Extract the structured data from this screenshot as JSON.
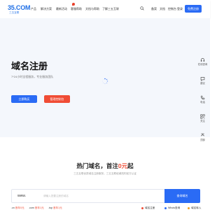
{
  "logo": {
    "text": "35.COM",
    "subtitle": "三五互联"
  },
  "nav": {
    "items": [
      {
        "label": "产品"
      },
      {
        "label": "解决方案"
      },
      {
        "label": "最新活动"
      },
      {
        "label": "客服帮助"
      },
      {
        "label": "文档与帮助"
      },
      {
        "label": "了解三五互联"
      }
    ]
  },
  "header": {
    "links": [
      {
        "label": "备案"
      },
      {
        "label": "文档"
      },
      {
        "label": "控制台"
      },
      {
        "label": "登录"
      }
    ],
    "register_label": "免费注册"
  },
  "hero": {
    "title": "域名注册",
    "subtitle": "7*24小时全程服务，专业服务团队",
    "primary_button": "立即购买",
    "secondary_button": "管理控制台"
  },
  "side_panel": {
    "items": [
      {
        "icon": "headset-icon",
        "label": "在线咨询"
      },
      {
        "icon": "chat-icon",
        "label": "建议"
      },
      {
        "icon": "phone-icon",
        "label": "电话"
      },
      {
        "icon": "qrcode-icon",
        "label": "关注"
      },
      {
        "icon": "arrow-up-icon",
        "label": "顶部"
      }
    ]
  },
  "domain_section": {
    "title_prefix": "热门域名，首注",
    "title_price": "0元",
    "title_suffix": "起",
    "subtitle": "三五互联优质域名注册服务，三五互联权威机构官方认证",
    "www_label": "www.",
    "search_placeholder": "请输入您要注册的域名",
    "search_button": "查询域名"
  },
  "prices": [
    {
      "ext": ".cn",
      "price": "首年0元"
    },
    {
      "ext": ".com",
      "price": "首年1元"
    },
    {
      "ext": ".top",
      "price": "首年1元"
    }
  ],
  "bottom_bar": {
    "items": [
      {
        "label": "域名注册"
      },
      {
        "label": "Whois查询"
      },
      {
        "label": "域名转入"
      }
    ]
  },
  "colors": {
    "primary": "#2a6bf5",
    "accent": "#f04c35",
    "hero_bg": "#f4f7fc"
  }
}
